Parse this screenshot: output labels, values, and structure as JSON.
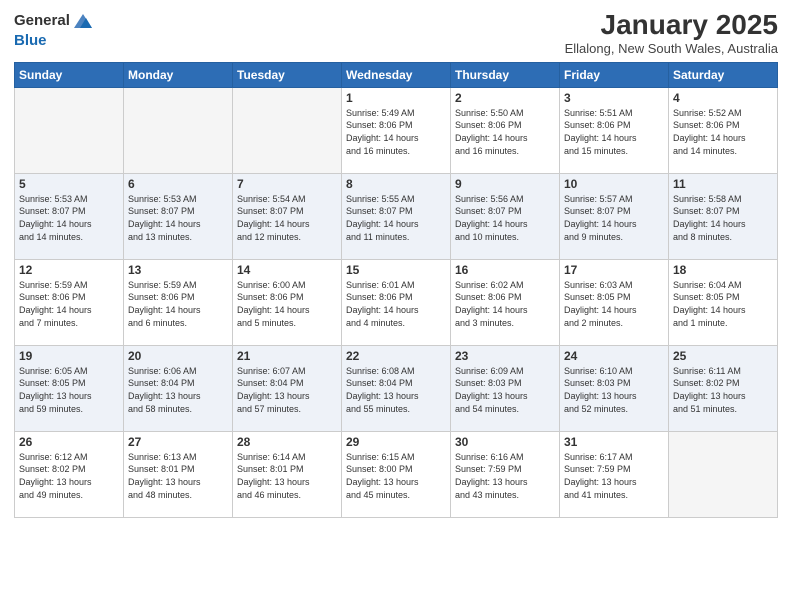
{
  "header": {
    "logo_line1": "General",
    "logo_line2": "Blue",
    "month_title": "January 2025",
    "location": "Ellalong, New South Wales, Australia"
  },
  "weekdays": [
    "Sunday",
    "Monday",
    "Tuesday",
    "Wednesday",
    "Thursday",
    "Friday",
    "Saturday"
  ],
  "weeks": [
    [
      {
        "day": "",
        "info": ""
      },
      {
        "day": "",
        "info": ""
      },
      {
        "day": "",
        "info": ""
      },
      {
        "day": "1",
        "info": "Sunrise: 5:49 AM\nSunset: 8:06 PM\nDaylight: 14 hours\nand 16 minutes."
      },
      {
        "day": "2",
        "info": "Sunrise: 5:50 AM\nSunset: 8:06 PM\nDaylight: 14 hours\nand 16 minutes."
      },
      {
        "day": "3",
        "info": "Sunrise: 5:51 AM\nSunset: 8:06 PM\nDaylight: 14 hours\nand 15 minutes."
      },
      {
        "day": "4",
        "info": "Sunrise: 5:52 AM\nSunset: 8:06 PM\nDaylight: 14 hours\nand 14 minutes."
      }
    ],
    [
      {
        "day": "5",
        "info": "Sunrise: 5:53 AM\nSunset: 8:07 PM\nDaylight: 14 hours\nand 14 minutes."
      },
      {
        "day": "6",
        "info": "Sunrise: 5:53 AM\nSunset: 8:07 PM\nDaylight: 14 hours\nand 13 minutes."
      },
      {
        "day": "7",
        "info": "Sunrise: 5:54 AM\nSunset: 8:07 PM\nDaylight: 14 hours\nand 12 minutes."
      },
      {
        "day": "8",
        "info": "Sunrise: 5:55 AM\nSunset: 8:07 PM\nDaylight: 14 hours\nand 11 minutes."
      },
      {
        "day": "9",
        "info": "Sunrise: 5:56 AM\nSunset: 8:07 PM\nDaylight: 14 hours\nand 10 minutes."
      },
      {
        "day": "10",
        "info": "Sunrise: 5:57 AM\nSunset: 8:07 PM\nDaylight: 14 hours\nand 9 minutes."
      },
      {
        "day": "11",
        "info": "Sunrise: 5:58 AM\nSunset: 8:07 PM\nDaylight: 14 hours\nand 8 minutes."
      }
    ],
    [
      {
        "day": "12",
        "info": "Sunrise: 5:59 AM\nSunset: 8:06 PM\nDaylight: 14 hours\nand 7 minutes."
      },
      {
        "day": "13",
        "info": "Sunrise: 5:59 AM\nSunset: 8:06 PM\nDaylight: 14 hours\nand 6 minutes."
      },
      {
        "day": "14",
        "info": "Sunrise: 6:00 AM\nSunset: 8:06 PM\nDaylight: 14 hours\nand 5 minutes."
      },
      {
        "day": "15",
        "info": "Sunrise: 6:01 AM\nSunset: 8:06 PM\nDaylight: 14 hours\nand 4 minutes."
      },
      {
        "day": "16",
        "info": "Sunrise: 6:02 AM\nSunset: 8:06 PM\nDaylight: 14 hours\nand 3 minutes."
      },
      {
        "day": "17",
        "info": "Sunrise: 6:03 AM\nSunset: 8:05 PM\nDaylight: 14 hours\nand 2 minutes."
      },
      {
        "day": "18",
        "info": "Sunrise: 6:04 AM\nSunset: 8:05 PM\nDaylight: 14 hours\nand 1 minute."
      }
    ],
    [
      {
        "day": "19",
        "info": "Sunrise: 6:05 AM\nSunset: 8:05 PM\nDaylight: 13 hours\nand 59 minutes."
      },
      {
        "day": "20",
        "info": "Sunrise: 6:06 AM\nSunset: 8:04 PM\nDaylight: 13 hours\nand 58 minutes."
      },
      {
        "day": "21",
        "info": "Sunrise: 6:07 AM\nSunset: 8:04 PM\nDaylight: 13 hours\nand 57 minutes."
      },
      {
        "day": "22",
        "info": "Sunrise: 6:08 AM\nSunset: 8:04 PM\nDaylight: 13 hours\nand 55 minutes."
      },
      {
        "day": "23",
        "info": "Sunrise: 6:09 AM\nSunset: 8:03 PM\nDaylight: 13 hours\nand 54 minutes."
      },
      {
        "day": "24",
        "info": "Sunrise: 6:10 AM\nSunset: 8:03 PM\nDaylight: 13 hours\nand 52 minutes."
      },
      {
        "day": "25",
        "info": "Sunrise: 6:11 AM\nSunset: 8:02 PM\nDaylight: 13 hours\nand 51 minutes."
      }
    ],
    [
      {
        "day": "26",
        "info": "Sunrise: 6:12 AM\nSunset: 8:02 PM\nDaylight: 13 hours\nand 49 minutes."
      },
      {
        "day": "27",
        "info": "Sunrise: 6:13 AM\nSunset: 8:01 PM\nDaylight: 13 hours\nand 48 minutes."
      },
      {
        "day": "28",
        "info": "Sunrise: 6:14 AM\nSunset: 8:01 PM\nDaylight: 13 hours\nand 46 minutes."
      },
      {
        "day": "29",
        "info": "Sunrise: 6:15 AM\nSunset: 8:00 PM\nDaylight: 13 hours\nand 45 minutes."
      },
      {
        "day": "30",
        "info": "Sunrise: 6:16 AM\nSunset: 7:59 PM\nDaylight: 13 hours\nand 43 minutes."
      },
      {
        "day": "31",
        "info": "Sunrise: 6:17 AM\nSunset: 7:59 PM\nDaylight: 13 hours\nand 41 minutes."
      },
      {
        "day": "",
        "info": ""
      }
    ]
  ]
}
